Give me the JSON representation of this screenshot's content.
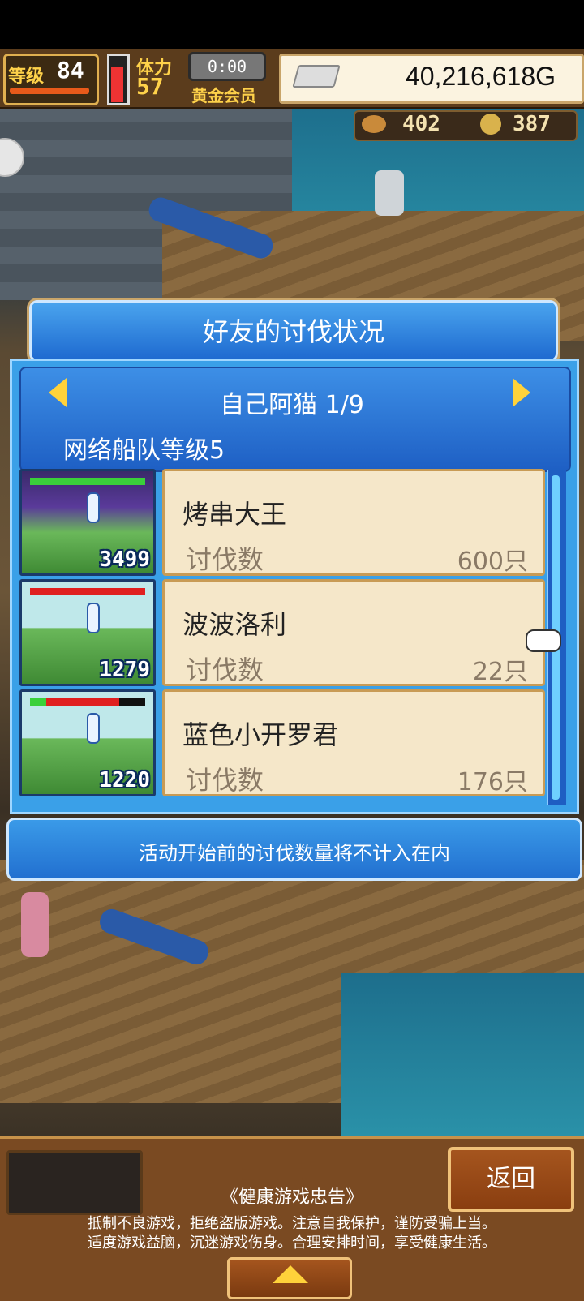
{
  "status": {
    "level_label": "等级",
    "level": "84",
    "stamina_label": "体力",
    "stamina": "57",
    "timer": "0:00",
    "member": "黄金会员",
    "gold": "40,216,618G",
    "resource1": "402",
    "resource2": "387"
  },
  "dialog": {
    "title": "好友的讨伐状况",
    "friend_name": "自己阿猫 1/9",
    "fleet_level": "网络船队等级5",
    "rows": [
      {
        "name": "烤串大王",
        "kill_label": "讨伐数",
        "kill_value": "600只",
        "power": "3499"
      },
      {
        "name": "波波洛利",
        "kill_label": "讨伐数",
        "kill_value": "22只",
        "power": "1279"
      },
      {
        "name": "蓝色小开罗君",
        "kill_label": "讨伐数",
        "kill_value": "176只",
        "power": "1220"
      }
    ],
    "footer_note": "活动开始前的讨伐数量将不计入在内"
  },
  "bottom": {
    "back_label": "返回",
    "health_title": "《健康游戏忠告》",
    "health_line1": "抵制不良游戏，拒绝盗版游戏。注意自我保护，谨防受骗上当。",
    "health_line2": "适度游戏益脑，沉迷游戏伤身。合理安排时间，享受健康生活。"
  },
  "icons": {
    "gold": "silver-ingot-icon",
    "resource1": "bread-icon",
    "resource2": "medal-icon",
    "hand": "pointing-hand-icon"
  }
}
